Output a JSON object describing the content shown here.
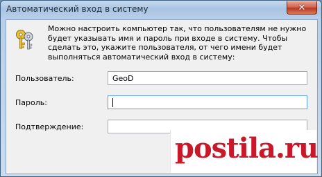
{
  "window": {
    "title": "Автоматический вход в систему"
  },
  "dialog": {
    "description": "Можно настроить компьютер так, что пользователям не нужно будет указывать имя и пароль при входе в систему. Чтобы сделать это, укажите пользователя, от чего имени будет выполняться автоматический вход в систему:",
    "fields": {
      "user": {
        "label": "Пользователь:",
        "value": "GeoD"
      },
      "password": {
        "label": "Пароль:",
        "value": ""
      },
      "confirm": {
        "label": "Подтверждение:",
        "value": ""
      }
    }
  },
  "watermark": {
    "text": "postila.ru"
  },
  "icons": {
    "keys": "keys-icon",
    "close": "close-icon"
  },
  "colors": {
    "watermark": "#c8182a",
    "focus_border": "#569de5",
    "close_button": "#c8452c"
  }
}
